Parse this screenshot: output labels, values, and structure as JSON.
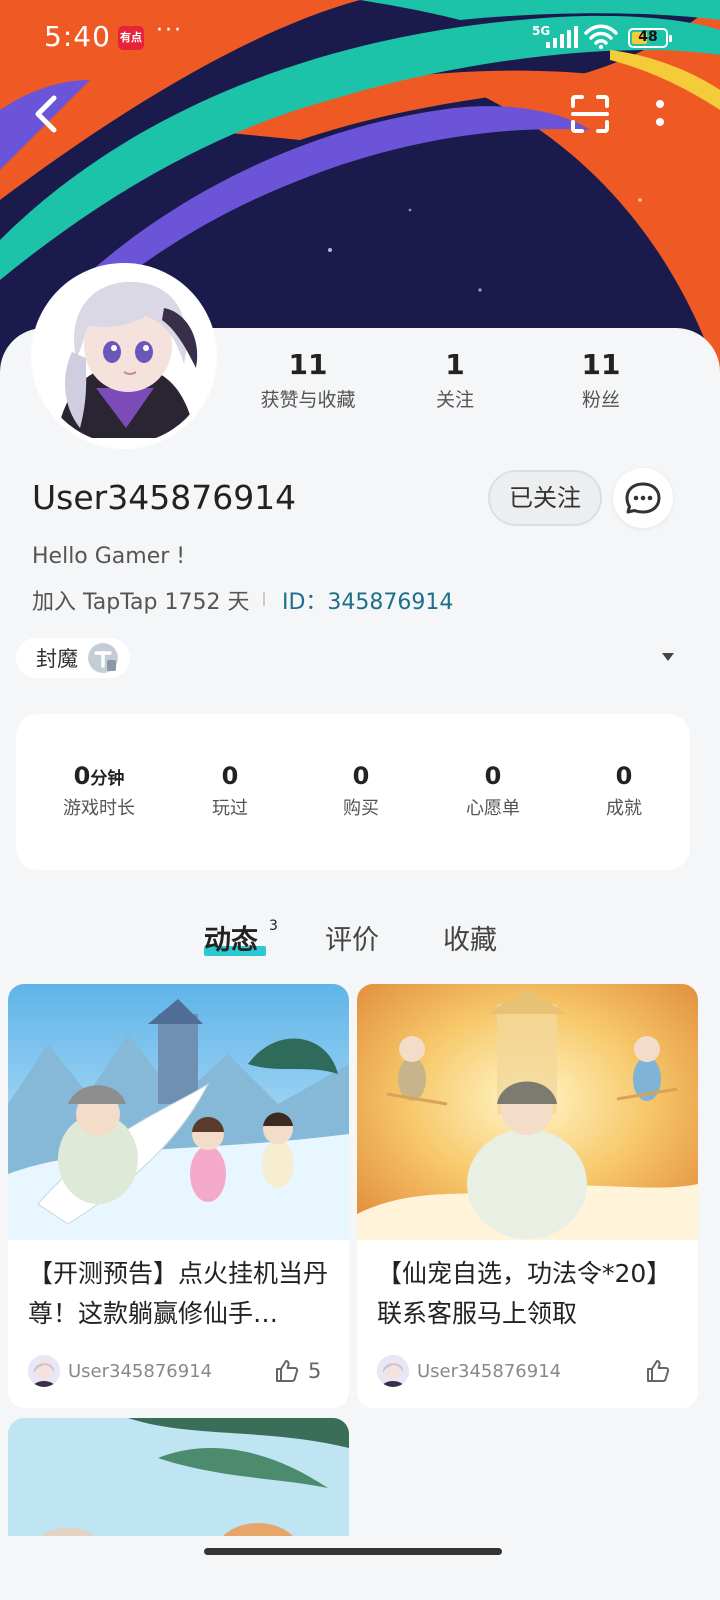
{
  "status_bar": {
    "time": "5:40",
    "app_badge": "有点",
    "more": "···",
    "network": "5G",
    "battery": "48",
    "battery_level": 0.48
  },
  "profile": {
    "username": "User345876914",
    "bio": "Hello Gamer !",
    "joined": "加入 TapTap 1752 天",
    "id_text": "ID：345876914",
    "follow_button": "已关注",
    "tag": "封魔"
  },
  "social_stats": [
    {
      "value": "11",
      "label": "获赞与收藏"
    },
    {
      "value": "1",
      "label": "关注"
    },
    {
      "value": "11",
      "label": "粉丝"
    }
  ],
  "game_stats": [
    {
      "value": "0",
      "unit": "分钟",
      "label": "游戏时长"
    },
    {
      "value": "0",
      "label": "玩过"
    },
    {
      "value": "0",
      "label": "购买"
    },
    {
      "value": "0",
      "label": "心愿单"
    },
    {
      "value": "0",
      "label": "成就"
    }
  ],
  "tabs": [
    {
      "label": "动态",
      "count": "3"
    },
    {
      "label": "评价"
    },
    {
      "label": "收藏"
    }
  ],
  "posts": [
    {
      "title": "【开测预告】点火挂机当丹尊！这款躺赢修仙手…",
      "author": "User345876914",
      "likes": "5"
    },
    {
      "title": "【仙宠自选，功法令*20】联系客服马上领取",
      "author": "User345876914",
      "likes": ""
    }
  ],
  "colors": {
    "accent": "#15c5ce",
    "banner_navy": "#1b1a4c",
    "banner_orange": "#ef5a24",
    "banner_teal": "#1cc3a9",
    "banner_purple": "#6b54d8",
    "id_link": "#1d6f8c"
  }
}
